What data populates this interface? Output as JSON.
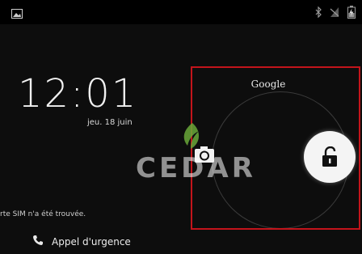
{
  "status_bar": {
    "left_icon": "image-notification-icon",
    "right_icons": [
      "bluetooth-icon",
      "signal-off-icon",
      "battery-charging-icon"
    ]
  },
  "lockscreen": {
    "time": "12:01",
    "date": "jeu. 18 juin",
    "sim_status": "rte SIM n'a été trouvée.",
    "emergency_call_label": "Appel d'urgence",
    "emergency_icon": "phone-icon"
  },
  "unlock_ring": {
    "google_label": "Google",
    "camera_icon": "camera-icon",
    "unlock_icon": "unlock-padlock-icon"
  },
  "watermark": {
    "text": "CEDAR",
    "accent_color": "#6aa83a"
  },
  "colors": {
    "background": "#0d0d0d",
    "highlight_border": "#c3141b"
  }
}
